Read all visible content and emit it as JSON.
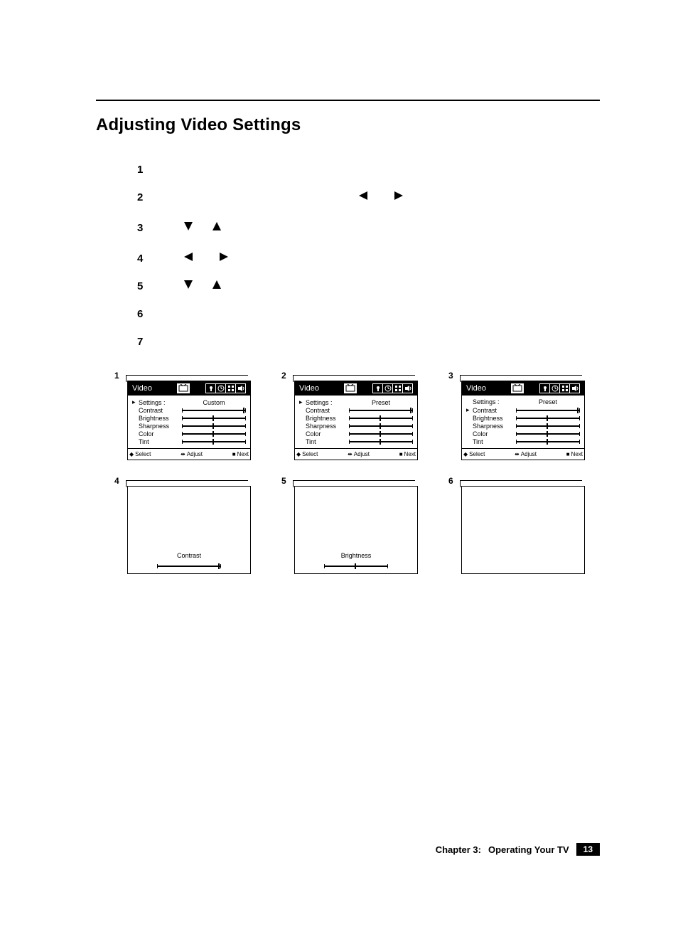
{
  "title": "Adjusting Video Settings",
  "steps": [
    "1",
    "2",
    "3",
    "4",
    "5",
    "6",
    "7"
  ],
  "osd": {
    "heading": "Video",
    "settings_label": "Settings :",
    "items": [
      "Contrast",
      "Brightness",
      "Sharpness",
      "Color",
      "Tint"
    ],
    "values": {
      "panel1": "Custom",
      "panel2": "Preset",
      "panel3": "Preset"
    },
    "footer": {
      "select": "Select",
      "adjust": "Adjust",
      "next": "Next"
    }
  },
  "live": {
    "panel4": "Contrast",
    "panel5": "Brightness"
  },
  "footer": {
    "chapter": "Chapter 3:",
    "title": "Operating Your TV",
    "page": "13"
  }
}
